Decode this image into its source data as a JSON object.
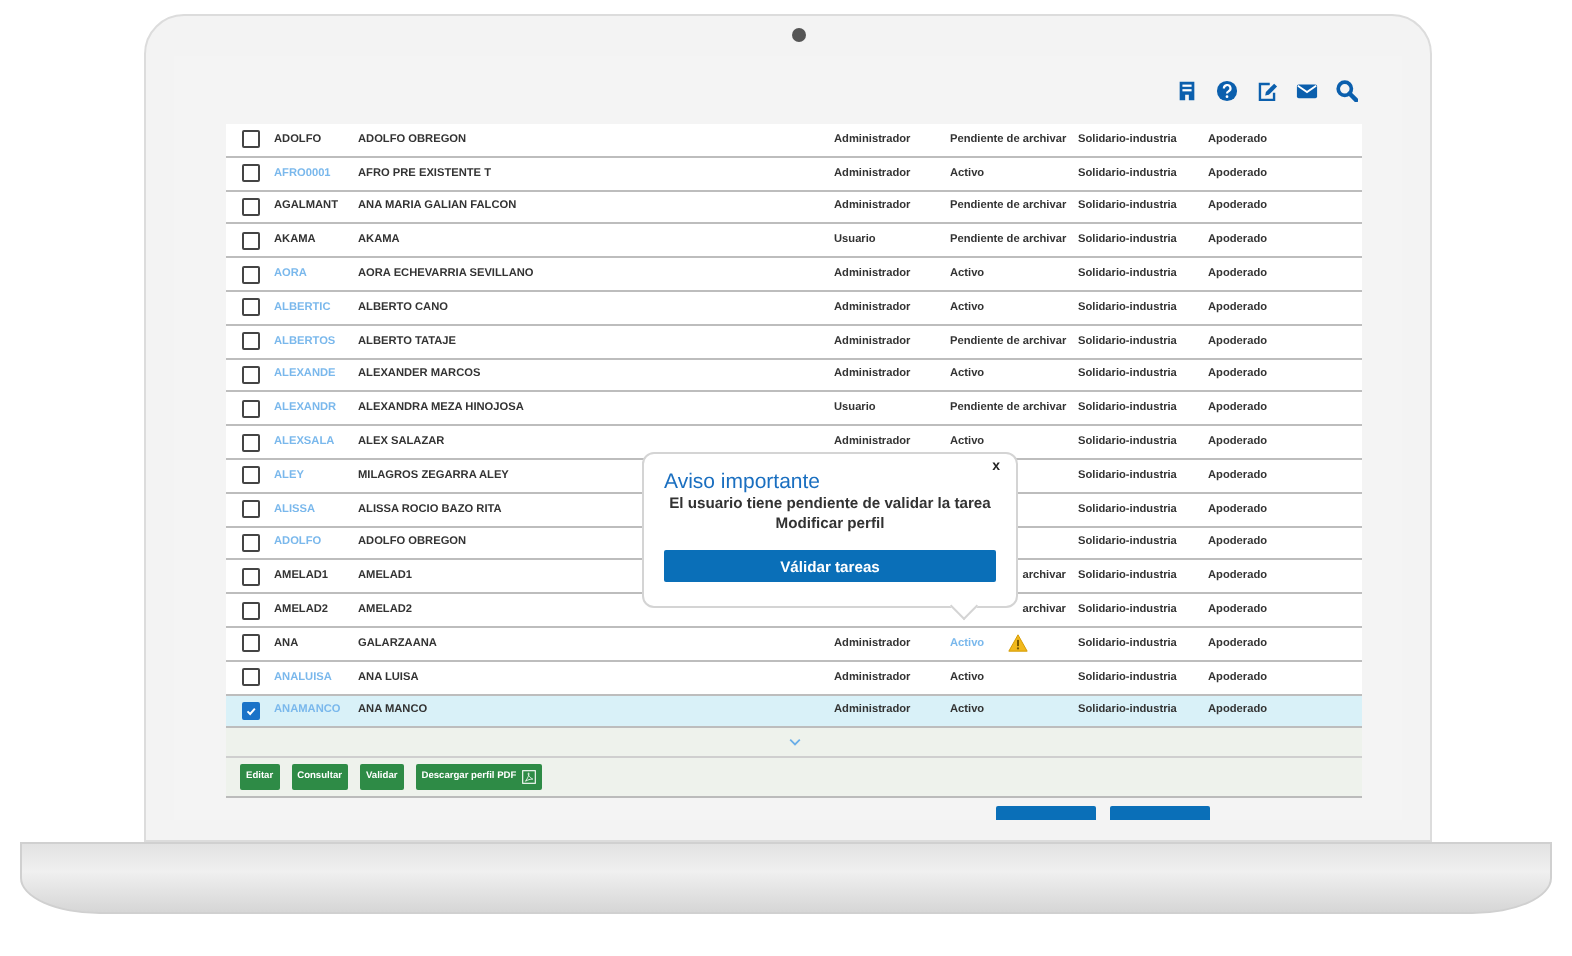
{
  "users": [
    {
      "checked": false,
      "selected": false,
      "username": "ADOLFO",
      "link": false,
      "name": "ADOLFO OBREGON",
      "role": "Administrador",
      "status": "Pendiente de archivar",
      "sector": "Solidario-industria",
      "representation": "Apoderado"
    },
    {
      "checked": false,
      "selected": false,
      "username": "AFRO0001",
      "link": true,
      "name": "AFRO PRE EXISTENTE T",
      "role": "Administrador",
      "status": "Activo",
      "sector": "Solidario-industria",
      "representation": "Apoderado"
    },
    {
      "checked": false,
      "selected": false,
      "username": "AGALMANT",
      "link": false,
      "name": "ANA MARIA GALIAN FALCON",
      "role": "Administrador",
      "status": "Pendiente de archivar",
      "sector": "Solidario-industria",
      "representation": "Apoderado"
    },
    {
      "checked": false,
      "selected": false,
      "username": "AKAMA",
      "link": false,
      "name": "AKAMA",
      "role": "Usuario",
      "status": "Pendiente de archivar",
      "sector": "Solidario-industria",
      "representation": "Apoderado"
    },
    {
      "checked": false,
      "selected": false,
      "username": "AORA",
      "link": true,
      "name": "AORA ECHEVARRIA SEVILLANO",
      "role": "Administrador",
      "status": "Activo",
      "sector": "Solidario-industria",
      "representation": "Apoderado"
    },
    {
      "checked": false,
      "selected": false,
      "username": "ALBERTIC",
      "link": true,
      "name": "ALBERTO CANO",
      "role": "Administrador",
      "status": "Activo",
      "sector": "Solidario-industria",
      "representation": "Apoderado"
    },
    {
      "checked": false,
      "selected": false,
      "username": "ALBERTOS",
      "link": true,
      "name": "ALBERTO TATAJE",
      "role": "Administrador",
      "status": "Pendiente de archivar",
      "sector": "Solidario-industria",
      "representation": "Apoderado"
    },
    {
      "checked": false,
      "selected": false,
      "username": "ALEXANDE",
      "link": true,
      "name": "ALEXANDER MARCOS",
      "role": "Administrador",
      "status": "Activo",
      "sector": "Solidario-industria",
      "representation": "Apoderado"
    },
    {
      "checked": false,
      "selected": false,
      "username": "ALEXANDR",
      "link": true,
      "name": "ALEXANDRA MEZA HINOJOSA",
      "role": "Usuario",
      "status": "Pendiente de archivar",
      "sector": "Solidario-industria",
      "representation": "Apoderado"
    },
    {
      "checked": false,
      "selected": false,
      "username": "ALEXSALA",
      "link": true,
      "name": "ALEX SALAZAR",
      "role": "Administrador",
      "status": "Activo",
      "sector": "Solidario-industria",
      "representation": "Apoderado"
    },
    {
      "checked": false,
      "selected": false,
      "username": "ALEY",
      "link": true,
      "name": "MILAGROS ZEGARRA ALEY",
      "sector": "Solidario-industria",
      "representation": "Apoderado"
    },
    {
      "checked": false,
      "selected": false,
      "username": "ALISSA",
      "link": true,
      "name": "ALISSA ROCIO BAZO RITA",
      "sector": "Solidario-industria",
      "representation": "Apoderado"
    },
    {
      "checked": false,
      "selected": false,
      "username": "ADOLFO",
      "link": true,
      "name": "ADOLFO OBREGON",
      "sector": "Solidario-industria",
      "representation": "Apoderado"
    },
    {
      "checked": false,
      "selected": false,
      "username": "AMELAD1",
      "link": false,
      "name": "AMELAD1",
      "status": "archivar",
      "status_clipped": true,
      "sector": "Solidario-industria",
      "representation": "Apoderado"
    },
    {
      "checked": false,
      "selected": false,
      "username": "AMELAD2",
      "link": false,
      "name": "AMELAD2",
      "status": "archivar",
      "status_clipped": true,
      "sector": "Solidario-industria",
      "representation": "Apoderado"
    },
    {
      "checked": false,
      "selected": false,
      "username": "ANA",
      "link": false,
      "name": "GALARZAANA",
      "role": "Administrador",
      "status": "Activo",
      "status_link": true,
      "warning": true,
      "sector": "Solidario-industria",
      "representation": "Apoderado"
    },
    {
      "checked": false,
      "selected": false,
      "username": "ANALUISA",
      "link": true,
      "name": "ANA LUISA",
      "role": "Administrador",
      "status": "Activo",
      "sector": "Solidario-industria",
      "representation": "Apoderado"
    },
    {
      "checked": true,
      "selected": true,
      "username": "ANAMANCO",
      "link": true,
      "name": "ANA MANCO",
      "role": "Administrador",
      "status": "Activo",
      "sector": "Solidario-industria",
      "representation": "Apoderado"
    }
  ],
  "actions": [
    {
      "label": "Editar",
      "pdf_icon": false
    },
    {
      "label": "Consultar",
      "pdf_icon": false
    },
    {
      "label": "Validar",
      "pdf_icon": false
    },
    {
      "label": "Descargar perfil PDF",
      "pdf_icon": true
    }
  ],
  "popup": {
    "close": "x",
    "title": "Aviso importante",
    "message": "El usuario tiene pendiente de validar la tarea",
    "task": "Modificar perfil",
    "button": "Válidar tareas"
  }
}
